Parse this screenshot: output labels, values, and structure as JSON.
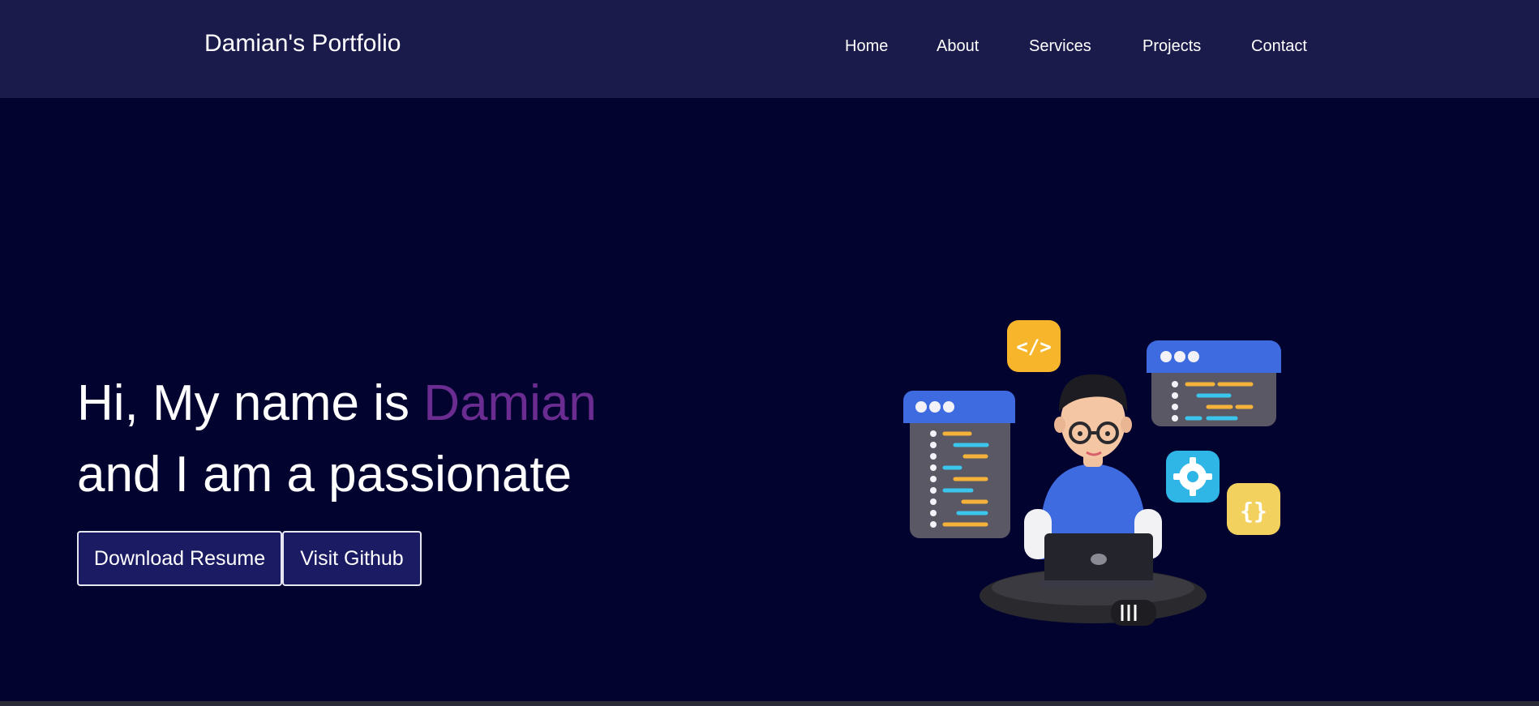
{
  "header": {
    "brand": "Damian's Portfolio",
    "nav": [
      {
        "label": "Home"
      },
      {
        "label": "About"
      },
      {
        "label": "Services"
      },
      {
        "label": "Projects"
      },
      {
        "label": "Contact"
      }
    ]
  },
  "hero": {
    "line1_prefix": "Hi, My name is ",
    "line1_name": "Damian",
    "line2": "and I am a passionate",
    "buttons": {
      "download_resume": "Download Resume",
      "visit_github": "Visit Github"
    },
    "illustration": {
      "icon_code": "</>",
      "icon_braces": "{}",
      "icon_gear": "gear-icon"
    }
  },
  "colors": {
    "nav_bg": "#1a1a4b",
    "page_bg": "#030330",
    "accent_name": "#6b2c91",
    "button_bg": "#1b1b64"
  }
}
